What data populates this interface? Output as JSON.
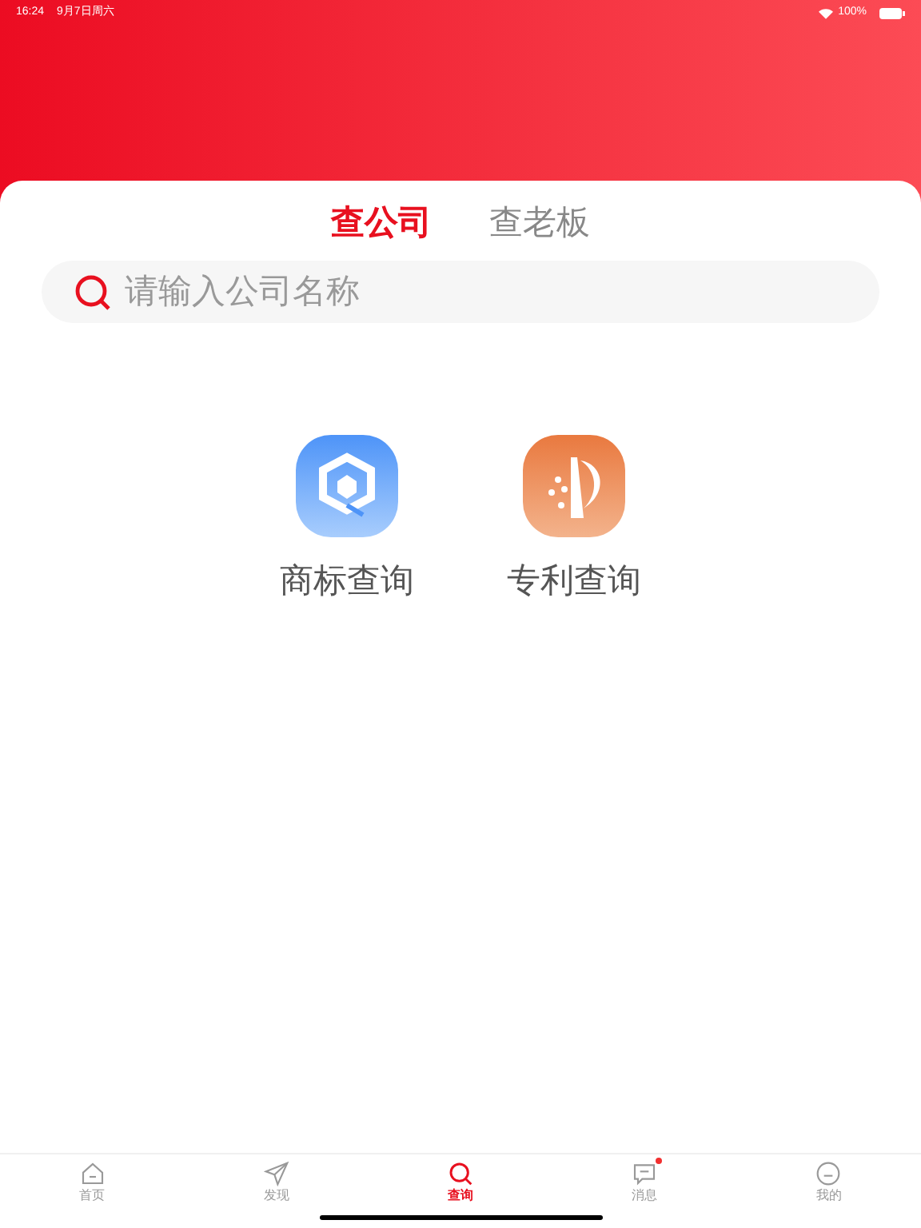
{
  "status_bar": {
    "time": "16:24",
    "date": "9月7日周六",
    "battery": "100%"
  },
  "tabs": [
    {
      "label": "查公司",
      "selected": true
    },
    {
      "label": "查老板",
      "selected": false
    }
  ],
  "search": {
    "placeholder": "请输入公司名称"
  },
  "services": [
    {
      "label": "商标查询"
    },
    {
      "label": "专利查询"
    }
  ],
  "nav": [
    {
      "label": "首页",
      "selected": false,
      "badge": false
    },
    {
      "label": "发现",
      "selected": false,
      "badge": false
    },
    {
      "label": "查询",
      "selected": true,
      "badge": false
    },
    {
      "label": "消息",
      "selected": false,
      "badge": true
    },
    {
      "label": "我的",
      "selected": false,
      "badge": false
    }
  ]
}
